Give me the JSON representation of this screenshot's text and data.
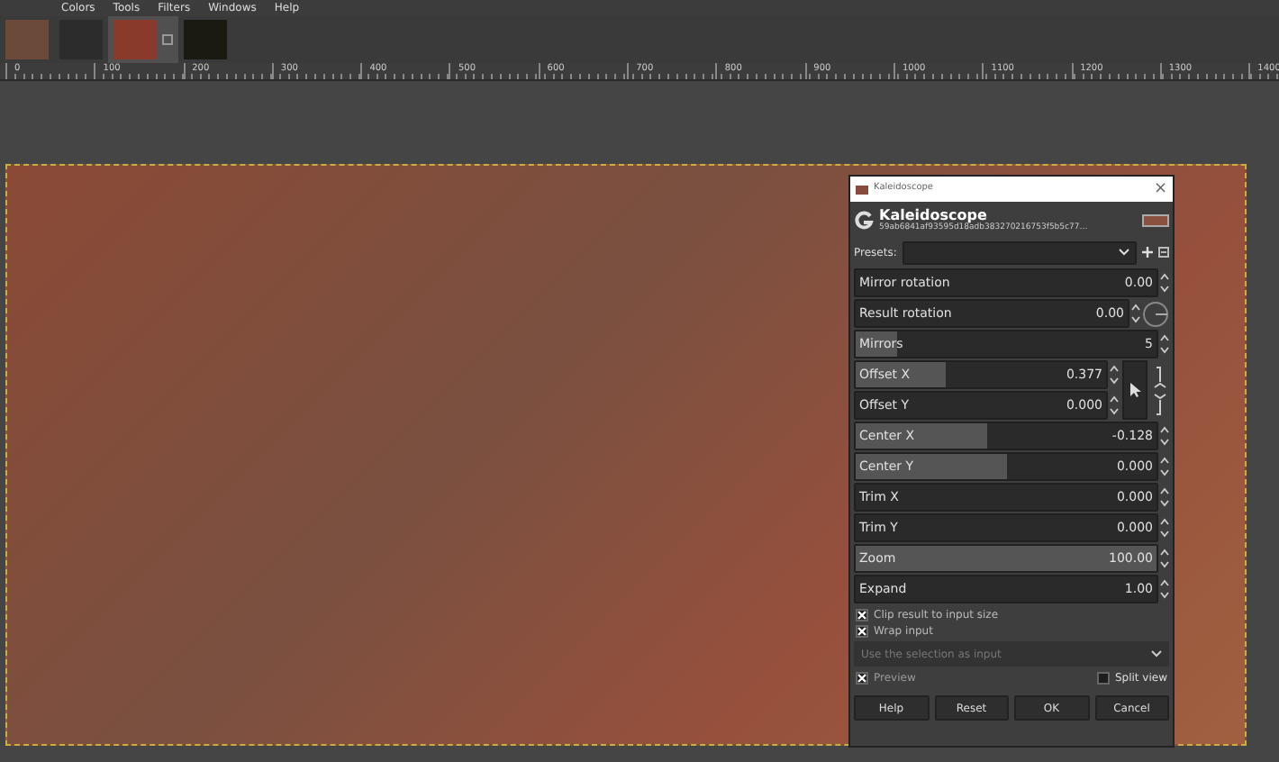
{
  "menu_bar": [
    "Colors",
    "Tools",
    "Filters",
    "Windows",
    "Help"
  ],
  "image_tabs": [
    {
      "selected": false
    },
    {
      "selected": false
    },
    {
      "selected": true
    },
    {
      "selected": false
    }
  ],
  "ruler": [
    "0",
    "100",
    "200",
    "300",
    "400",
    "500",
    "600",
    "700",
    "800",
    "900",
    "1000",
    "1100",
    "1200",
    "1300",
    "1400"
  ],
  "dialog": {
    "title": "Kaleidoscope",
    "close": "×",
    "name": "Kaleidoscope",
    "hash": "59ab6841af93595d18adb383270216753f5b5c77…",
    "presets_label": "Presets:",
    "controls": [
      {
        "kind": "slider",
        "label": "Mirror rotation",
        "value": "0.00",
        "level": 0
      },
      {
        "kind": "angle",
        "label": "Result rotation",
        "value": "0.00",
        "level": 0
      },
      {
        "kind": "slider",
        "label": "Mirrors",
        "value": "5",
        "level": 0.14
      },
      {
        "kind": "pair",
        "fields": [
          {
            "label": "Offset X",
            "value": "0.377",
            "level": 0.36
          },
          {
            "label": "Offset Y",
            "value": "0.000",
            "level": 0
          }
        ]
      },
      {
        "kind": "slider",
        "label": "Center X",
        "value": "-0.128",
        "level": 0.44
      },
      {
        "kind": "slider",
        "label": "Center Y",
        "value": "0.000",
        "level": 0.5
      },
      {
        "kind": "slider",
        "label": "Trim X",
        "value": "0.000",
        "level": 0
      },
      {
        "kind": "slider",
        "label": "Trim Y",
        "value": "0.000",
        "level": 0
      },
      {
        "kind": "slider",
        "label": "Zoom",
        "value": "100.00",
        "level": 1
      },
      {
        "kind": "slider",
        "label": "Expand",
        "value": "1.00",
        "level": 0
      }
    ],
    "options": [
      {
        "label": "Clip result to input size",
        "checked": true
      },
      {
        "label": "Wrap input",
        "checked": true
      }
    ],
    "input_select": "Use the selection as input",
    "preview": {
      "label": "Preview",
      "checked": true
    },
    "split_view": {
      "label": "Split view",
      "checked": false
    },
    "buttons": [
      "Help",
      "Reset",
      "OK",
      "Cancel"
    ]
  }
}
